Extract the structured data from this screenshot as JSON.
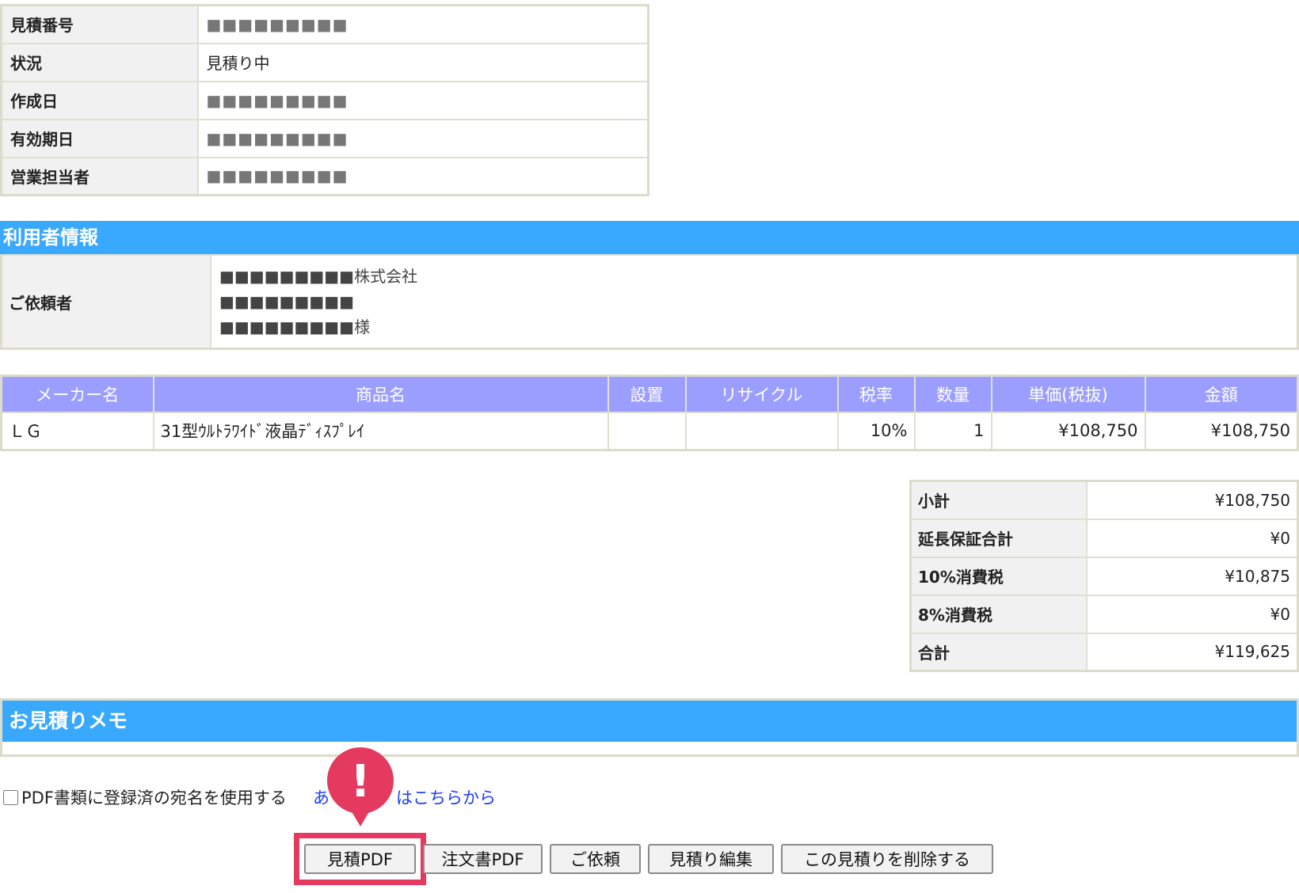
{
  "info": {
    "rows": [
      {
        "label": "見積番号",
        "value": "■■■■■■■■■"
      },
      {
        "label": "状況",
        "value": "見積り中"
      },
      {
        "label": "作成日",
        "value": "■■■■■■■■■"
      },
      {
        "label": "有効期日",
        "value": "■■■■■■■■■"
      },
      {
        "label": "営業担当者",
        "value": "■■■■■■■■■"
      }
    ]
  },
  "user_section": {
    "title": "利用者情報",
    "requester_label": "ご依頼者",
    "lines": [
      "■■■■■■■■■株式会社",
      "■■■■■■■■■",
      "■■■■■■■■■様"
    ]
  },
  "products": {
    "headers": [
      "メーカー名",
      "商品名",
      "設置",
      "リサイクル",
      "税率",
      "数量",
      "単価(税抜)",
      "金額"
    ],
    "row": {
      "maker": "ＬＧ",
      "name": "31型ｳﾙﾄﾗﾜｲﾄﾞ液晶ﾃﾞｨｽﾌﾟﾚｲ",
      "install": "",
      "recycle": "",
      "tax_rate": "10%",
      "qty": "1",
      "unit_price": "¥108,750",
      "amount": "¥108,750"
    }
  },
  "totals": [
    {
      "label": "小計",
      "value": "¥108,750"
    },
    {
      "label": "延長保証合計",
      "value": "¥0"
    },
    {
      "label": "10%消費税",
      "value": "¥10,875"
    },
    {
      "label": "8%消費税",
      "value": "¥0"
    },
    {
      "label": "合計",
      "value": "¥119,625"
    }
  ],
  "memo": {
    "title": "お見積りメモ"
  },
  "pdf_option_label": "PDF書類に登録済の宛名を使用する",
  "address_link": "あ　　　　はこちらから",
  "alert_mark": "!",
  "buttons": {
    "quote_pdf": "見積PDF",
    "order_pdf": "注文書PDF",
    "request": "ご依頼",
    "edit": "見積り編集",
    "delete": "この見積りを削除する"
  },
  "colors": {
    "section_bar": "#39a9ff",
    "table_header": "#9b9eff",
    "highlight": "#e53a5f",
    "link": "#1a3cff"
  }
}
